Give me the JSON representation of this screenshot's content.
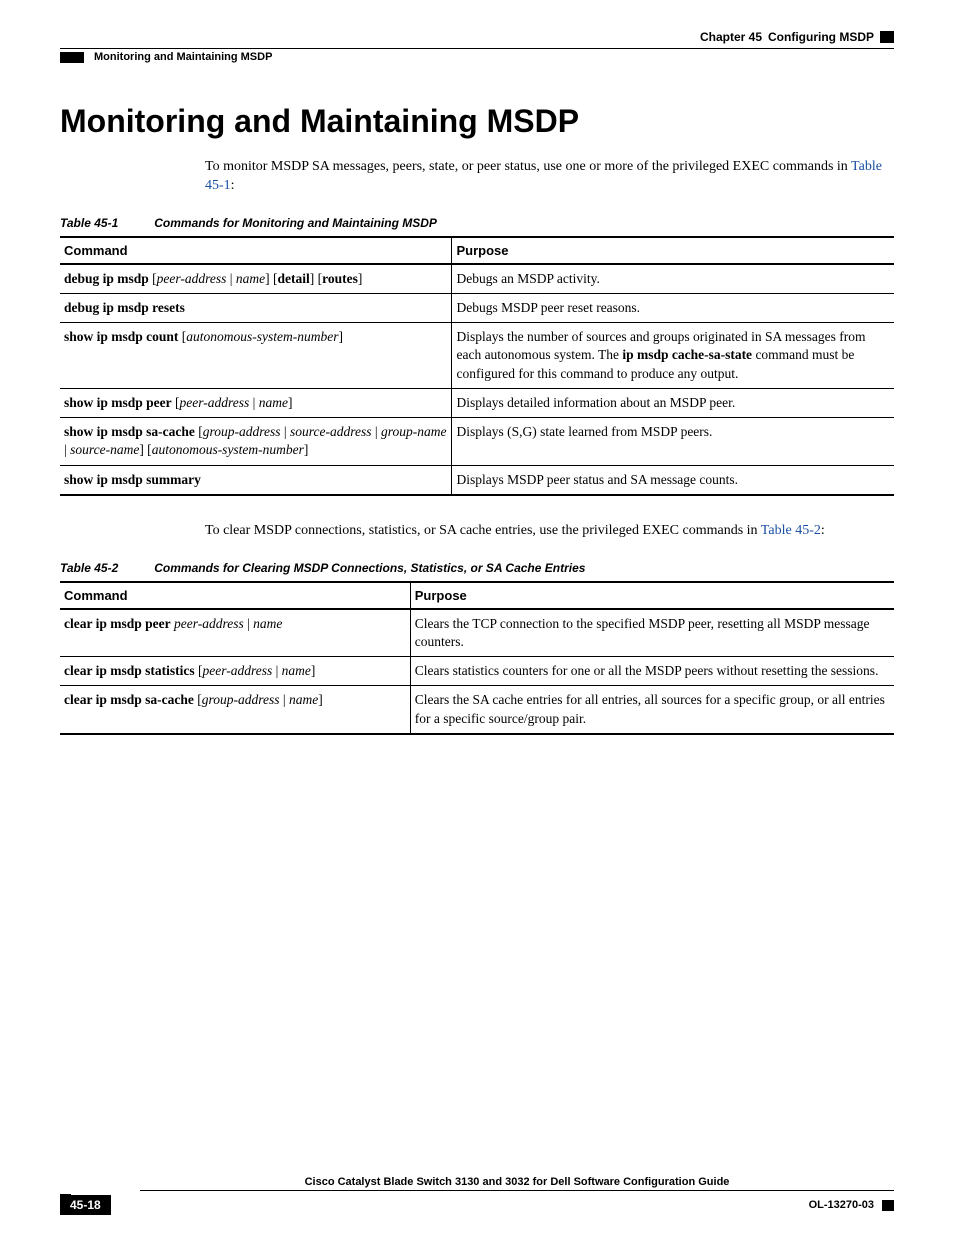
{
  "header": {
    "chapter_label": "Chapter 45",
    "chapter_title": "Configuring MSDP",
    "section": "Monitoring and Maintaining MSDP"
  },
  "title": "Monitoring and Maintaining MSDP",
  "intro": {
    "pre": "To monitor MSDP SA messages, peers, state, or peer status, use one or more of the privileged EXEC commands in ",
    "link": "Table 45-1",
    "post": ":"
  },
  "table1": {
    "num": "Table 45-1",
    "title": "Commands for Monitoring and Maintaining MSDP",
    "headers": {
      "col1": "Command",
      "col2": "Purpose"
    },
    "rows": [
      {
        "cmd_parts": [
          {
            "t": "debug ip msdp",
            "b": true
          },
          {
            "t": " ["
          },
          {
            "t": "peer-address",
            "i": true
          },
          {
            "t": " | "
          },
          {
            "t": "name",
            "i": true
          },
          {
            "t": "] ["
          },
          {
            "t": "detail",
            "b": true
          },
          {
            "t": "] ["
          },
          {
            "t": "routes",
            "b": true
          },
          {
            "t": "]"
          }
        ],
        "purpose_parts": [
          {
            "t": "Debugs an MSDP activity."
          }
        ]
      },
      {
        "cmd_parts": [
          {
            "t": "debug ip msdp resets",
            "b": true
          }
        ],
        "purpose_parts": [
          {
            "t": "Debugs MSDP peer reset reasons."
          }
        ]
      },
      {
        "cmd_parts": [
          {
            "t": "show ip msdp count",
            "b": true
          },
          {
            "t": " ["
          },
          {
            "t": "autonomous-system-number",
            "i": true
          },
          {
            "t": "]"
          }
        ],
        "purpose_parts": [
          {
            "t": "Displays the number of sources and groups originated in SA messages from each autonomous system. The "
          },
          {
            "t": "ip msdp cache-sa-state",
            "b": true
          },
          {
            "t": " command must be configured for this command to produce any output."
          }
        ]
      },
      {
        "cmd_parts": [
          {
            "t": "show ip msdp peer",
            "b": true
          },
          {
            "t": " ["
          },
          {
            "t": "peer-address",
            "i": true
          },
          {
            "t": " | "
          },
          {
            "t": "name",
            "i": true
          },
          {
            "t": "]"
          }
        ],
        "purpose_parts": [
          {
            "t": "Displays detailed information about an MSDP peer."
          }
        ]
      },
      {
        "cmd_parts": [
          {
            "t": "show ip msdp sa-cache",
            "b": true
          },
          {
            "t": " ["
          },
          {
            "t": "group-address",
            "i": true
          },
          {
            "t": " | "
          },
          {
            "t": "source-address",
            "i": true
          },
          {
            "t": " | "
          },
          {
            "t": "group-name",
            "i": true
          },
          {
            "t": " | "
          },
          {
            "t": "source-name",
            "i": true
          },
          {
            "t": "] ["
          },
          {
            "t": "autonomous-system-number",
            "i": true
          },
          {
            "t": "]"
          }
        ],
        "purpose_parts": [
          {
            "t": "Displays (S,G) state learned from MSDP peers."
          }
        ]
      },
      {
        "cmd_parts": [
          {
            "t": "show ip msdp summary",
            "b": true
          }
        ],
        "purpose_parts": [
          {
            "t": "Displays MSDP peer status and SA message counts."
          }
        ]
      }
    ]
  },
  "mid": {
    "pre": "To clear MSDP connections, statistics, or SA cache entries, use the privileged EXEC commands in ",
    "link": "Table 45-2",
    "post": ":"
  },
  "table2": {
    "num": "Table 45-2",
    "title": "Commands for Clearing MSDP Connections, Statistics, or SA Cache Entries",
    "headers": {
      "col1": "Command",
      "col2": "Purpose"
    },
    "rows": [
      {
        "cmd_parts": [
          {
            "t": "clear ip msdp peer",
            "b": true
          },
          {
            "t": " "
          },
          {
            "t": "peer-address",
            "i": true
          },
          {
            "t": " | "
          },
          {
            "t": "name",
            "i": true
          }
        ],
        "purpose_parts": [
          {
            "t": "Clears the TCP connection to the specified MSDP peer, resetting all MSDP message counters."
          }
        ]
      },
      {
        "cmd_parts": [
          {
            "t": "clear ip msdp statistics",
            "b": true
          },
          {
            "t": " ["
          },
          {
            "t": "peer-address",
            "i": true
          },
          {
            "t": " | "
          },
          {
            "t": "name",
            "i": true
          },
          {
            "t": "]"
          }
        ],
        "purpose_parts": [
          {
            "t": "Clears statistics counters for one or all the MSDP peers without resetting the sessions."
          }
        ]
      },
      {
        "cmd_parts": [
          {
            "t": "clear ip msdp sa-cache",
            "b": true
          },
          {
            "t": " ["
          },
          {
            "t": "group-address",
            "i": true
          },
          {
            "t": " | "
          },
          {
            "t": "name",
            "i": true
          },
          {
            "t": "]"
          }
        ],
        "purpose_parts": [
          {
            "t": "Clears the SA cache entries for all entries, all sources for a specific group, or all entries for a specific source/group pair."
          }
        ]
      }
    ]
  },
  "footer": {
    "book": "Cisco Catalyst Blade Switch 3130 and 3032 for Dell Software Configuration Guide",
    "page": "45-18",
    "docid": "OL-13270-03"
  }
}
